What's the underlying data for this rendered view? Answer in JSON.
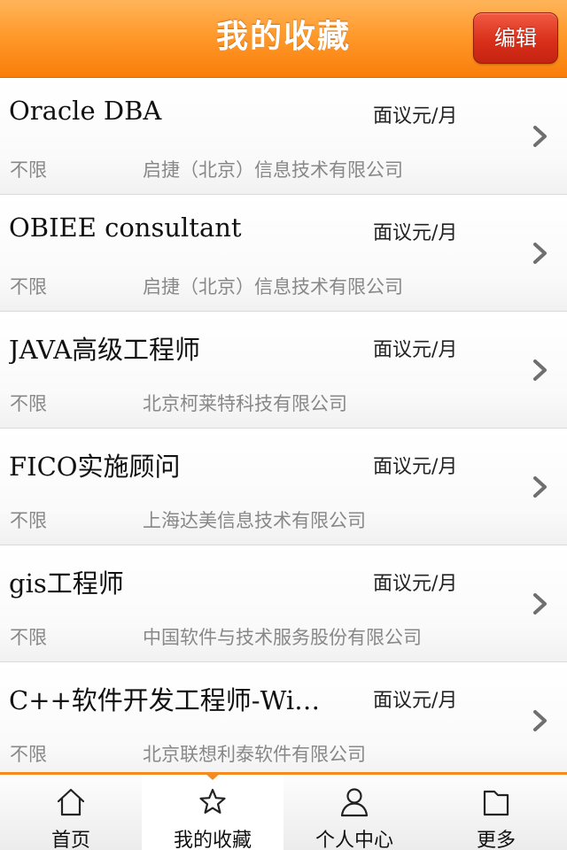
{
  "header": {
    "title": "我的收藏",
    "edit_label": "编辑"
  },
  "favorites": [
    {
      "title": "Oracle DBA",
      "salary": "面议元/月",
      "location": "不限",
      "company": "启捷（北京）信息技术有限公司"
    },
    {
      "title": "OBIEE consultant",
      "salary": "面议元/月",
      "location": "不限",
      "company": "启捷（北京）信息技术有限公司"
    },
    {
      "title": "JAVA高级工程师",
      "salary": "面议元/月",
      "location": "不限",
      "company": "北京柯莱特科技有限公司"
    },
    {
      "title": "FICO实施顾问",
      "salary": "面议元/月",
      "location": "不限",
      "company": "上海达美信息技术有限公司"
    },
    {
      "title": "gis工程师",
      "salary": "面议元/月",
      "location": "不限",
      "company": "中国软件与技术服务股份有限公司"
    },
    {
      "title": "C++软件开发工程师-Wi…",
      "salary": "面议元/月",
      "location": "不限",
      "company": "北京联想利泰软件有限公司"
    }
  ],
  "tabbar": {
    "tabs": [
      {
        "label": "首页",
        "icon": "home-icon"
      },
      {
        "label": "我的收藏",
        "icon": "star-icon",
        "active": true
      },
      {
        "label": "个人中心",
        "icon": "user-icon"
      },
      {
        "label": "更多",
        "icon": "folder-icon"
      }
    ]
  },
  "colors": {
    "header_orange": "#f97e0a",
    "edit_button_red": "#d9301a",
    "tab_accent": "#f58a1f",
    "secondary_text": "#888888"
  }
}
